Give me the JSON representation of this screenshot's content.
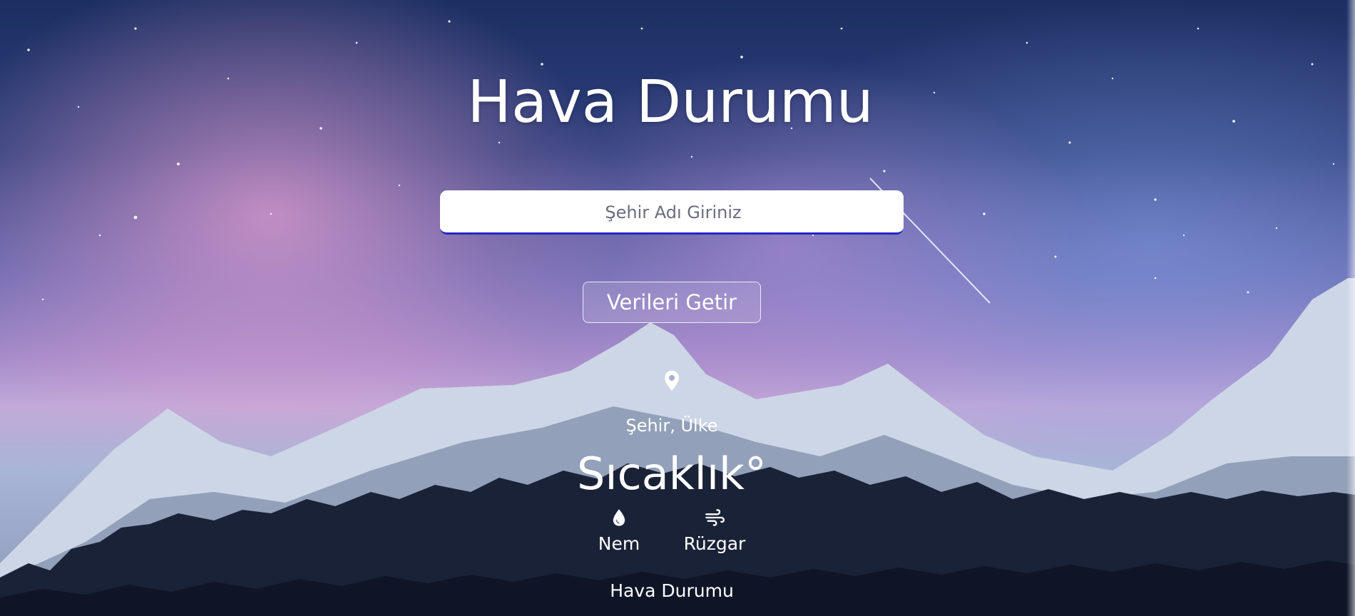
{
  "header": {
    "title": "Hava Durumu"
  },
  "search": {
    "placeholder": "Şehir Adı Giriniz",
    "value": ""
  },
  "actions": {
    "fetch_label": "Verileri Getir"
  },
  "weather": {
    "location_icon": "location-pin-icon",
    "location": "Şehir, Ülke",
    "temperature": "Sıcaklık°",
    "humidity_icon": "water-drop-icon",
    "humidity_label": "Nem",
    "wind_icon": "wind-icon",
    "wind_label": "Rüzgar",
    "description": "Hava Durumu"
  },
  "colors": {
    "text": "#ffffff",
    "search_underline": "#2626c7",
    "search_background": "#ffffff"
  }
}
